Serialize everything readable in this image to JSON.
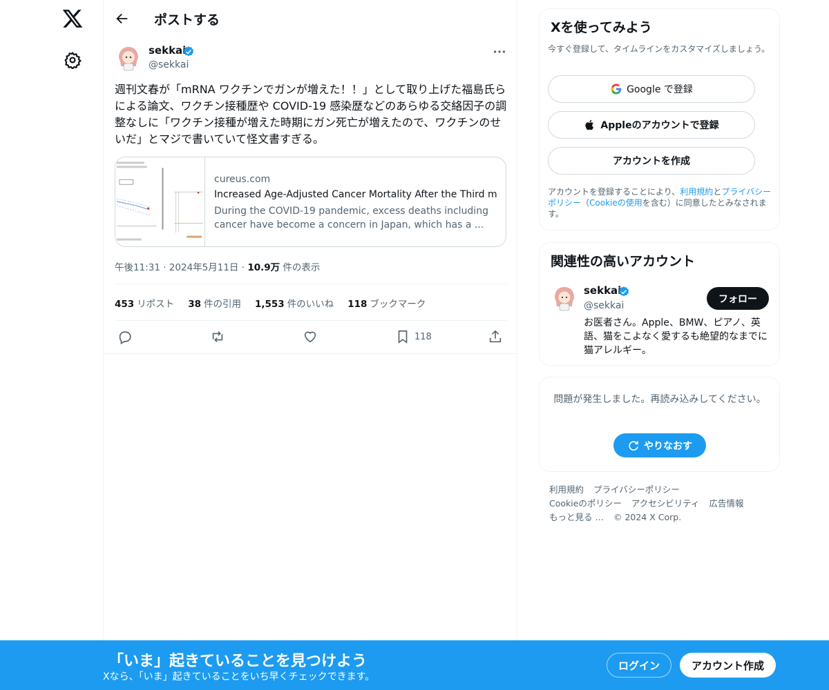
{
  "header": {
    "title": "ポストする"
  },
  "post": {
    "author_name": "sekkai",
    "author_handle": "@sekkai",
    "text": "週刊文春が「mRNA ワクチンでガンが増えた！！」として取り上げた福島氏らによる論文、ワクチン接種歴や COVID-19 感染歴などのあらゆる交絡因子の調整なしに「ワクチン接種が増えた時期にガン死亡が増えたので、ワクチンのせいだ」とマジで書いていて怪文書すぎる。",
    "card": {
      "domain": "cureus.com",
      "title": "Increased Age-Adjusted Cancer Mortality After the Third mRNA",
      "description": "During the COVID-19 pandemic, excess deaths including cancer have become a concern in Japan, which has a ..."
    },
    "time": "午後11:31",
    "date": "2024年5月11日",
    "views_count": "10.9万",
    "views_label": "件の表示",
    "reposts_count": "453",
    "reposts_label": "リポスト",
    "quotes_count": "38",
    "quotes_label": "件の引用",
    "likes_count": "1,553",
    "likes_label": "件のいいね",
    "bookmarks_count": "118",
    "bookmarks_label": "ブックマーク",
    "bookmark_action_count": "118"
  },
  "signup_panel": {
    "title": "Xを使ってみよう",
    "subtitle": "今すぐ登録して、タイムラインをカスタマイズしましょう。",
    "google_label": "Google で登録",
    "apple_label": "Appleのアカウントで登録",
    "create_label": "アカウントを作成",
    "terms_prefix": "アカウントを登録することにより、",
    "terms_link": "利用規約",
    "terms_and": "と",
    "privacy_link": "プライバシーポリシー",
    "cookie_open": "（",
    "cookie_link": "Cookieの使用",
    "terms_suffix": "を含む）に同意したとみなされます。"
  },
  "related_panel": {
    "title": "関連性の高いアカウント",
    "name": "sekkai",
    "handle": "@sekkai",
    "follow_label": "フォロー",
    "bio": "お医者さん。Apple、BMW、ピアノ、英語、猫をこよなく愛するも絶望的なまでに猫アレルギー。"
  },
  "error_panel": {
    "message": "問題が発生しました。再読み込みしてください。",
    "retry_label": "やりなおす"
  },
  "footer": {
    "terms": "利用規約",
    "privacy": "プライバシーポリシー",
    "cookie": "Cookieのポリシー",
    "accessibility": "アクセシビリティ",
    "ads": "広告情報",
    "more": "もっと見る …",
    "copyright": "© 2024 X Corp."
  },
  "bottom_bar": {
    "title": "「いま」起きていることを見つけよう",
    "subtitle": "Xなら、「いま」起きていることをいち早くチェックできます。",
    "login_label": "ログイン",
    "signup_label": "アカウント作成"
  },
  "colors": {
    "accent": "#1d9bf0",
    "text": "#0f1419",
    "muted": "#536471",
    "border": "#eff3f4"
  },
  "icons": {
    "logo": "x-logo-icon",
    "settings": "gear-icon",
    "back": "arrow-left-icon",
    "verified": "verified-badge-icon",
    "more": "more-icon",
    "reply": "reply-icon",
    "repost": "repost-icon",
    "like": "heart-icon",
    "bookmark": "bookmark-icon",
    "share": "share-icon",
    "google": "google-icon",
    "apple": "apple-icon",
    "retry": "refresh-icon"
  }
}
